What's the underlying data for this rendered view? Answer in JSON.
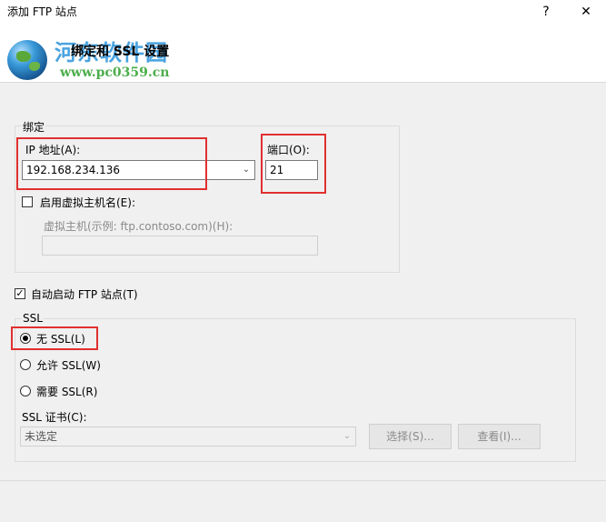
{
  "window": {
    "title": "添加 FTP 站点",
    "help_label": "?",
    "close_label": "✕"
  },
  "header": {
    "title": "绑定和 SSL 设置",
    "watermark_name": "河东软件园",
    "watermark_url": "www.pc0359.cn"
  },
  "binding": {
    "group_label": "绑定",
    "ip_label": "IP 地址(A):",
    "ip_value": "192.168.234.136",
    "port_label": "端口(O):",
    "port_value": "21",
    "virtual_host_checkbox_label": "启用虚拟主机名(E):",
    "virtual_host_checked": false,
    "virtual_host_label": "虚拟主机(示例: ftp.contoso.com)(H):",
    "virtual_host_value": ""
  },
  "auto_start": {
    "label": "自动启动 FTP 站点(T)",
    "checked": true
  },
  "ssl": {
    "group_label": "SSL",
    "options": [
      {
        "label": "无 SSL(L)",
        "selected": true
      },
      {
        "label": "允许 SSL(W)",
        "selected": false
      },
      {
        "label": "需要 SSL(R)",
        "selected": false
      }
    ],
    "cert_label": "SSL 证书(C):",
    "cert_value": "未选定",
    "select_button": "选择(S)...",
    "view_button": "查看(I)..."
  },
  "colors": {
    "highlight": "#e03030",
    "header_bg": "#ffffff",
    "dialog_bg": "#f0f0f0"
  }
}
